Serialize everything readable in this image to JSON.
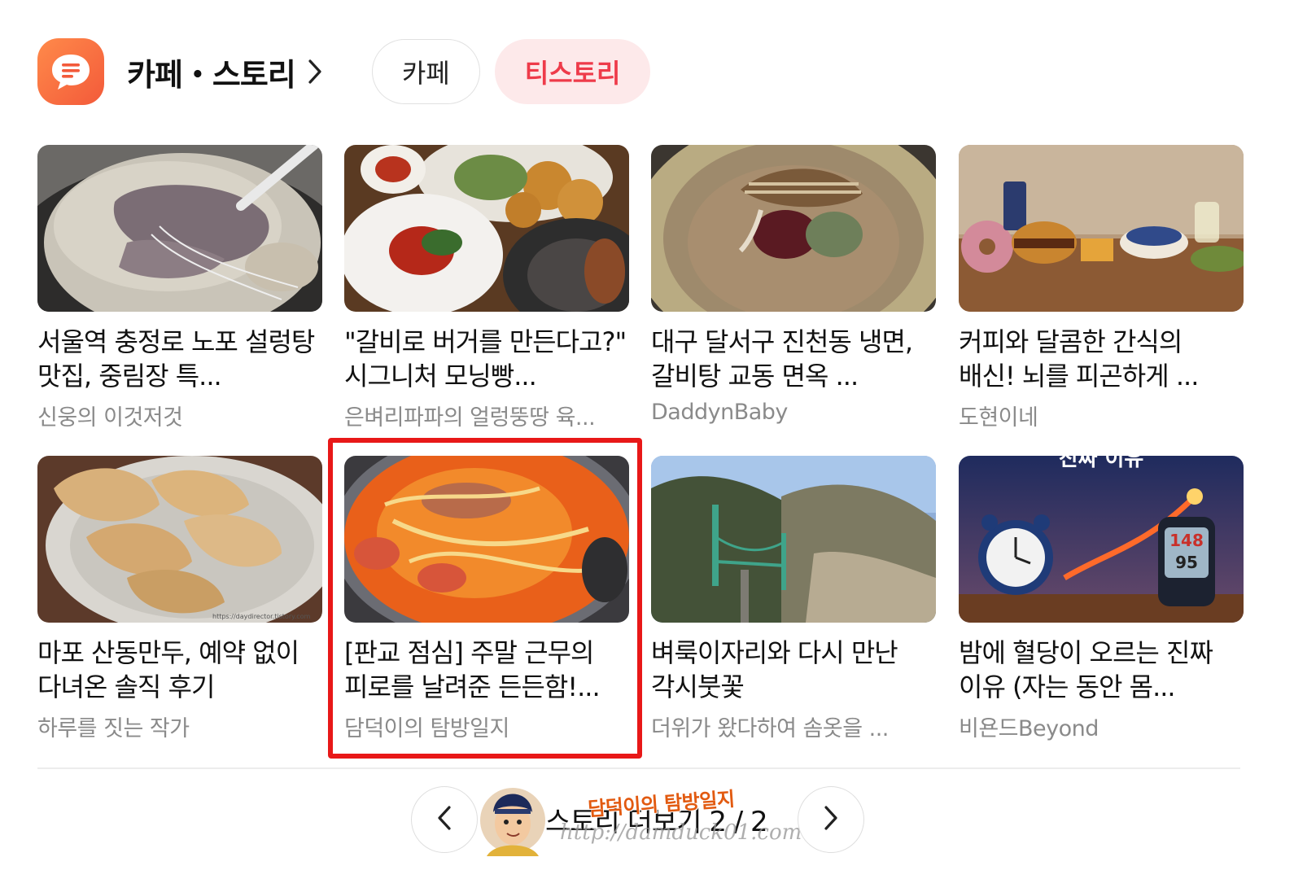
{
  "header": {
    "title": "카페・스토리",
    "tabs": [
      {
        "label": "카페",
        "active": false
      },
      {
        "label": "티스토리",
        "active": true
      }
    ]
  },
  "cards": [
    {
      "title": "서울역 충정로 노포 설렁탕 맛집, 중림장 특...",
      "source": "신웅의 이것저것"
    },
    {
      "title": "\"갈비로 버거를 만든다고?\" 시그니처 모닝빵...",
      "source": "은벼리파파의 얼렁뚱땅 육..."
    },
    {
      "title": "대구 달서구 진천동 냉면, 갈비탕 교동 면옥 ...",
      "source": "DaddynBaby"
    },
    {
      "title": "커피와 달콤한 간식의 배신! 뇌를 피곤하게 ...",
      "source": "도현이네"
    },
    {
      "title": "마포 산동만두, 예약 없이 다녀온 솔직 후기",
      "source": "하루를 짓는 작가",
      "thumb_caption": "https://daydirector.tistory.com"
    },
    {
      "title": "[판교 점심] 주말 근무의 피로를 날려준 든든함!...",
      "source": "담덕이의 탐방일지",
      "highlighted": true
    },
    {
      "title": "벼룩이자리와 다시 만난 각시붓꽃",
      "source": "더위가 왔다하여 솜옷을 ..."
    },
    {
      "title": "밤에 혈당이 오르는 진짜 이유 (자는 동안 몸...",
      "source": "비욘드Beyond",
      "thumb_text": {
        "banner": "진짜 이유",
        "bp_sys": "148",
        "bp_dia": "95"
      }
    }
  ],
  "footer": {
    "more_label": "스토리 더보기",
    "page": "2",
    "total": "/ 2",
    "watermark_name": "담덕이의 탐방일지",
    "watermark_url": "http://damduck01.com"
  },
  "colors": {
    "accent": "#ee3b4a",
    "accent_bg": "#fde9ea",
    "icon_orange": "#f46a3c",
    "highlight_red": "#e81818"
  },
  "icons": [
    "chat-bubble-icon",
    "chevron-right-icon",
    "chevron-left-icon"
  ]
}
